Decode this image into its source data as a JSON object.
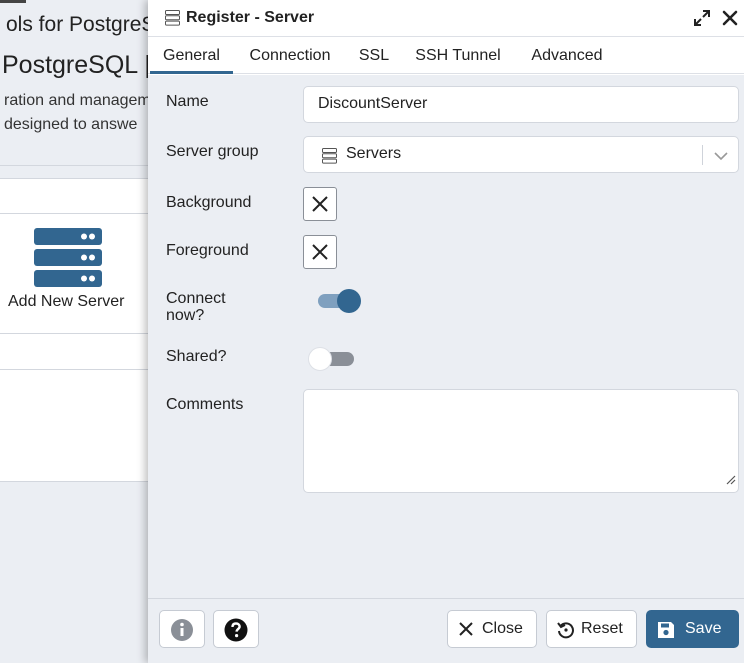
{
  "background": {
    "title_fragment": "ols for PostgreS",
    "heading_fragment": "PostgreSQL |",
    "text_line1": "ration and managem",
    "text_line2": " designed to answe",
    "add_server_label": "Add New Server"
  },
  "dialog": {
    "title": "Register - Server",
    "tabs": [
      {
        "label": "General",
        "active": true
      },
      {
        "label": "Connection",
        "active": false
      },
      {
        "label": "SSL",
        "active": false
      },
      {
        "label": "SSH Tunnel",
        "active": false
      },
      {
        "label": "Advanced",
        "active": false
      }
    ],
    "form": {
      "name_label": "Name",
      "name_value": "DiscountServer",
      "server_group_label": "Server group",
      "server_group_value": "Servers",
      "background_label": "Background",
      "foreground_label": "Foreground",
      "connect_now_label": "Connect now?",
      "connect_now_value": true,
      "shared_label": "Shared?",
      "shared_value": false,
      "comments_label": "Comments",
      "comments_value": ""
    },
    "footer": {
      "close_label": "Close",
      "reset_label": "Reset",
      "save_label": "Save"
    }
  },
  "colors": {
    "accent": "#326690",
    "toggle_track_on": "#7fa0bf",
    "toggle_track_off": "#8a8f97",
    "form_background": "#ebeef3"
  },
  "icons": {
    "title": "server-group-icon",
    "expand": "expand-icon",
    "close": "close-icon",
    "select": "server-group-icon",
    "chevron": "chevron-down-icon",
    "color_swatch": "x-icon",
    "info": "info-icon",
    "help": "help-icon",
    "close_button": "x-icon",
    "reset": "reset-icon",
    "save": "floppy-disk-icon",
    "add_server": "server-icon"
  }
}
